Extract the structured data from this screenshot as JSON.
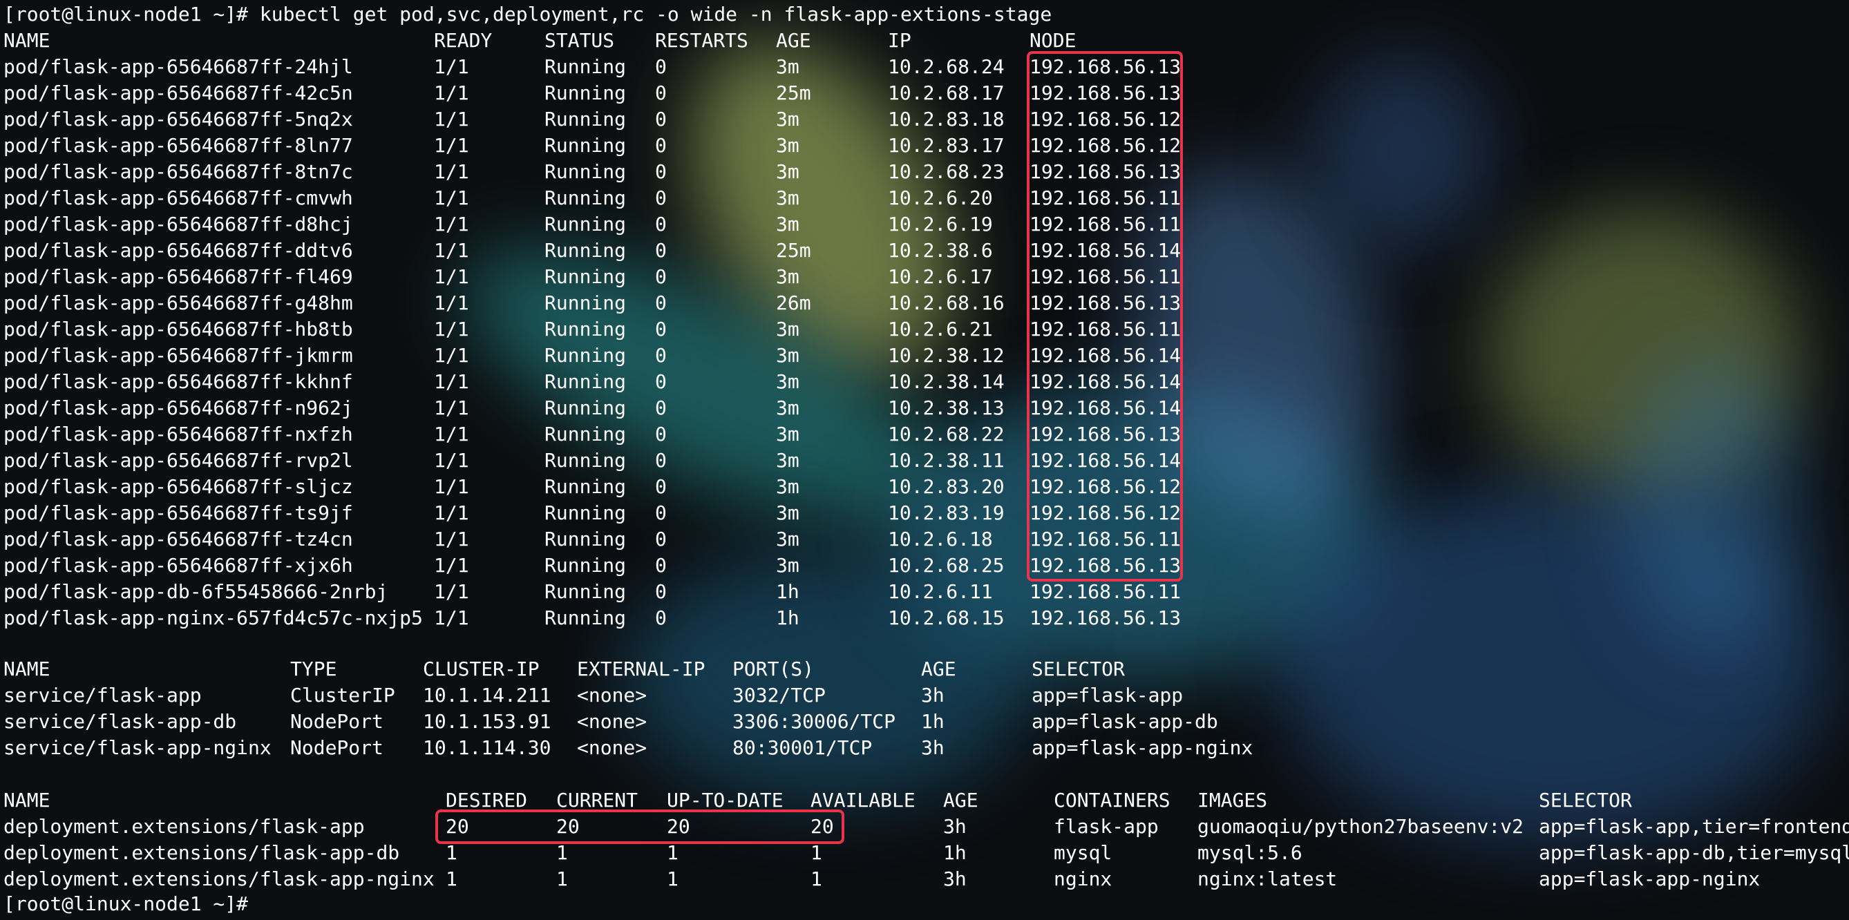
{
  "prompt_user": "[root@linux-node1 ~]# ",
  "command": "kubectl get pod,svc,deployment,rc -o wide -n flask-app-extions-stage",
  "pods": {
    "headers": [
      "NAME",
      "READY",
      "STATUS",
      "RESTARTS",
      "AGE",
      "IP",
      "NODE"
    ],
    "rows": [
      [
        "pod/flask-app-65646687ff-24hjl",
        "1/1",
        "Running",
        "0",
        "3m",
        "10.2.68.24",
        "192.168.56.13"
      ],
      [
        "pod/flask-app-65646687ff-42c5n",
        "1/1",
        "Running",
        "0",
        "25m",
        "10.2.68.17",
        "192.168.56.13"
      ],
      [
        "pod/flask-app-65646687ff-5nq2x",
        "1/1",
        "Running",
        "0",
        "3m",
        "10.2.83.18",
        "192.168.56.12"
      ],
      [
        "pod/flask-app-65646687ff-8ln77",
        "1/1",
        "Running",
        "0",
        "3m",
        "10.2.83.17",
        "192.168.56.12"
      ],
      [
        "pod/flask-app-65646687ff-8tn7c",
        "1/1",
        "Running",
        "0",
        "3m",
        "10.2.68.23",
        "192.168.56.13"
      ],
      [
        "pod/flask-app-65646687ff-cmvwh",
        "1/1",
        "Running",
        "0",
        "3m",
        "10.2.6.20",
        "192.168.56.11"
      ],
      [
        "pod/flask-app-65646687ff-d8hcj",
        "1/1",
        "Running",
        "0",
        "3m",
        "10.2.6.19",
        "192.168.56.11"
      ],
      [
        "pod/flask-app-65646687ff-ddtv6",
        "1/1",
        "Running",
        "0",
        "25m",
        "10.2.38.6",
        "192.168.56.14"
      ],
      [
        "pod/flask-app-65646687ff-fl469",
        "1/1",
        "Running",
        "0",
        "3m",
        "10.2.6.17",
        "192.168.56.11"
      ],
      [
        "pod/flask-app-65646687ff-g48hm",
        "1/1",
        "Running",
        "0",
        "26m",
        "10.2.68.16",
        "192.168.56.13"
      ],
      [
        "pod/flask-app-65646687ff-hb8tb",
        "1/1",
        "Running",
        "0",
        "3m",
        "10.2.6.21",
        "192.168.56.11"
      ],
      [
        "pod/flask-app-65646687ff-jkmrm",
        "1/1",
        "Running",
        "0",
        "3m",
        "10.2.38.12",
        "192.168.56.14"
      ],
      [
        "pod/flask-app-65646687ff-kkhnf",
        "1/1",
        "Running",
        "0",
        "3m",
        "10.2.38.14",
        "192.168.56.14"
      ],
      [
        "pod/flask-app-65646687ff-n962j",
        "1/1",
        "Running",
        "0",
        "3m",
        "10.2.38.13",
        "192.168.56.14"
      ],
      [
        "pod/flask-app-65646687ff-nxfzh",
        "1/1",
        "Running",
        "0",
        "3m",
        "10.2.68.22",
        "192.168.56.13"
      ],
      [
        "pod/flask-app-65646687ff-rvp2l",
        "1/1",
        "Running",
        "0",
        "3m",
        "10.2.38.11",
        "192.168.56.14"
      ],
      [
        "pod/flask-app-65646687ff-sljcz",
        "1/1",
        "Running",
        "0",
        "3m",
        "10.2.83.20",
        "192.168.56.12"
      ],
      [
        "pod/flask-app-65646687ff-ts9jf",
        "1/1",
        "Running",
        "0",
        "3m",
        "10.2.83.19",
        "192.168.56.12"
      ],
      [
        "pod/flask-app-65646687ff-tz4cn",
        "1/1",
        "Running",
        "0",
        "3m",
        "10.2.6.18",
        "192.168.56.11"
      ],
      [
        "pod/flask-app-65646687ff-xjx6h",
        "1/1",
        "Running",
        "0",
        "3m",
        "10.2.68.25",
        "192.168.56.13"
      ],
      [
        "pod/flask-app-db-6f55458666-2nrbj",
        "1/1",
        "Running",
        "0",
        "1h",
        "10.2.6.11",
        "192.168.56.11"
      ],
      [
        "pod/flask-app-nginx-657fd4c57c-nxjp5",
        "1/1",
        "Running",
        "0",
        "1h",
        "10.2.68.15",
        "192.168.56.13"
      ]
    ]
  },
  "services": {
    "headers": [
      "NAME",
      "TYPE",
      "CLUSTER-IP",
      "EXTERNAL-IP",
      "PORT(S)",
      "AGE",
      "SELECTOR"
    ],
    "rows": [
      [
        "service/flask-app",
        "ClusterIP",
        "10.1.14.211",
        "<none>",
        "3032/TCP",
        "3h",
        "app=flask-app"
      ],
      [
        "service/flask-app-db",
        "NodePort",
        "10.1.153.91",
        "<none>",
        "3306:30006/TCP",
        "1h",
        "app=flask-app-db"
      ],
      [
        "service/flask-app-nginx",
        "NodePort",
        "10.1.114.30",
        "<none>",
        "80:30001/TCP",
        "3h",
        "app=flask-app-nginx"
      ]
    ]
  },
  "deployments": {
    "headers": [
      "NAME",
      "DESIRED",
      "CURRENT",
      "UP-TO-DATE",
      "AVAILABLE",
      "AGE",
      "CONTAINERS",
      "IMAGES",
      "SELECTOR"
    ],
    "rows": [
      [
        "deployment.extensions/flask-app",
        "20",
        "20",
        "20",
        "20",
        "3h",
        "flask-app",
        "guomaoqiu/python27baseenv:v2",
        "app=flask-app,tier=frontend"
      ],
      [
        "deployment.extensions/flask-app-db",
        "1",
        "1",
        "1",
        "1",
        "1h",
        "mysql",
        "mysql:5.6",
        "app=flask-app-db,tier=mysql"
      ],
      [
        "deployment.extensions/flask-app-nginx",
        "1",
        "1",
        "1",
        "1",
        "3h",
        "nginx",
        "nginx:latest",
        "app=flask-app-nginx"
      ]
    ]
  },
  "final_prompt": "[root@linux-node1 ~]#",
  "colors": {
    "text": "#ffffff",
    "highlight": "#e8334a",
    "background": "#0b0d10"
  }
}
